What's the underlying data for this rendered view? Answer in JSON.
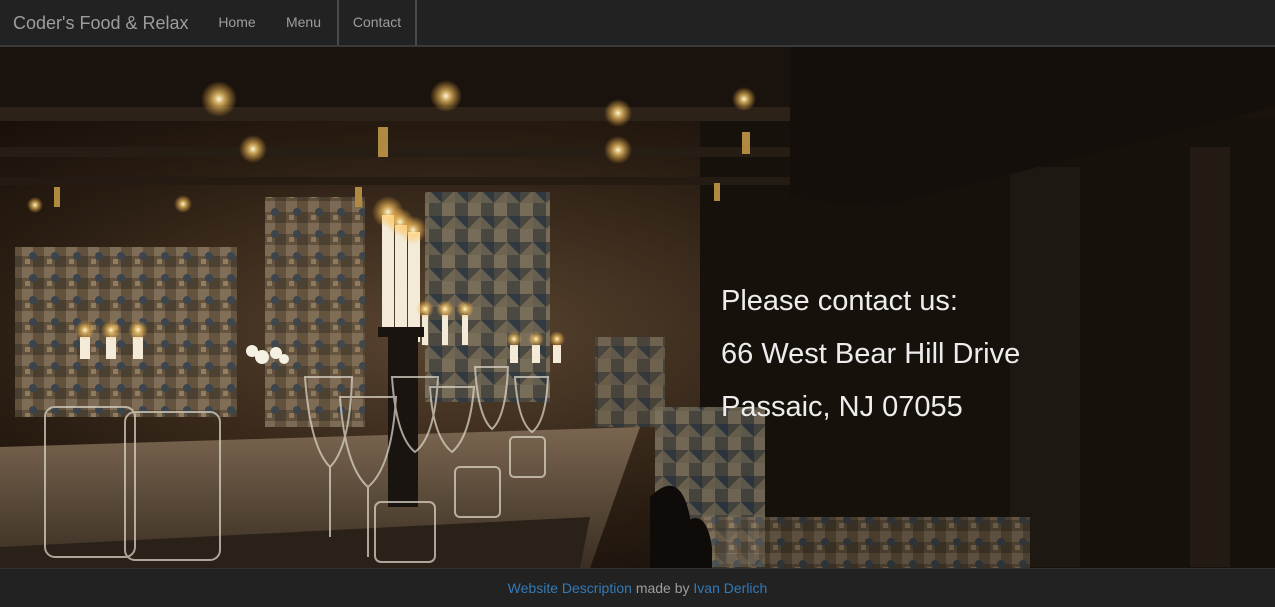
{
  "navbar": {
    "brand": "Coder's Food & Relax",
    "items": [
      {
        "label": "Home"
      },
      {
        "label": "Menu"
      },
      {
        "label": "Contact"
      }
    ]
  },
  "hero": {
    "image_alt": "restaurant interior with candles and wine glasses",
    "contact": {
      "heading": "Please contact us:",
      "address_line1": "66 West Bear Hill Drive",
      "address_line2": "Passaic, NJ 07055"
    }
  },
  "footer": {
    "link1": "Website Description",
    "middle": "made by",
    "link2": "Ivan Derlich"
  },
  "colors": {
    "navbar_bg": "#222222",
    "nav_text": "#9d9d9d",
    "link": "#337ab7",
    "hero_text": "#ededed"
  }
}
